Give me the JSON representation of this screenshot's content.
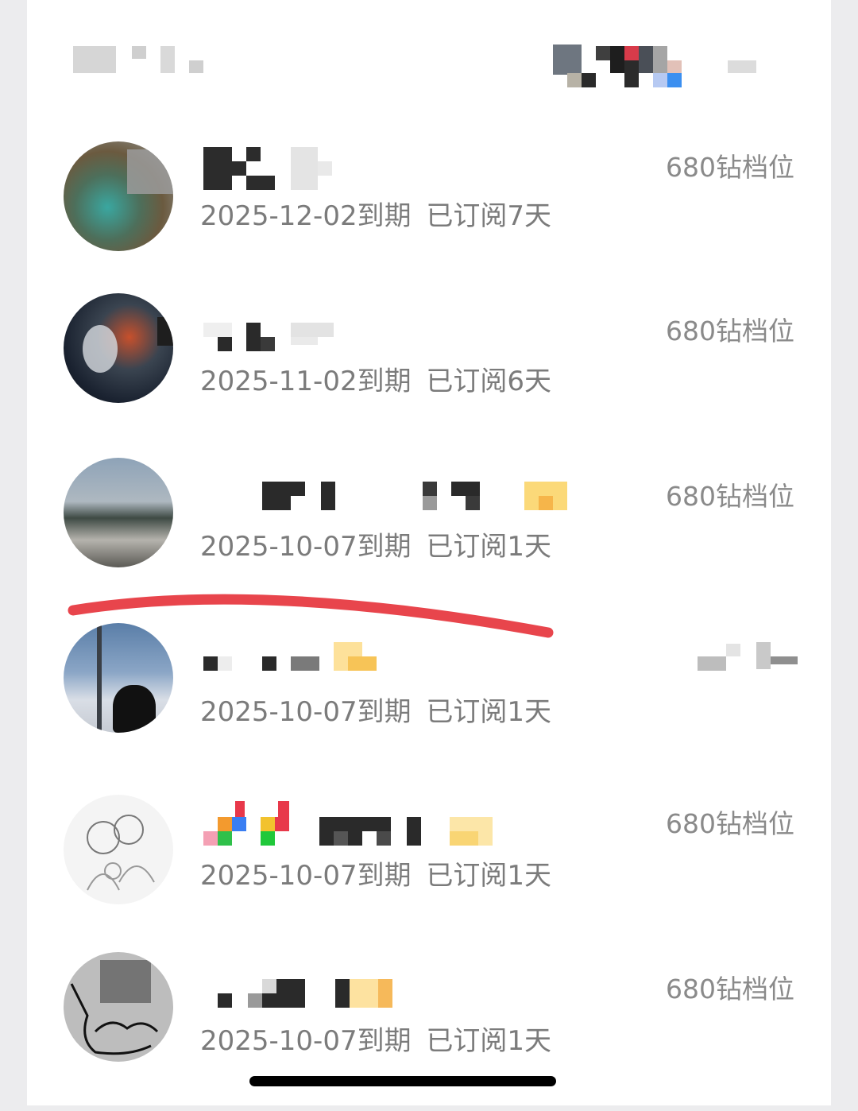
{
  "list": {
    "items": [
      {
        "expiry": "2025-12-02到期",
        "subscribed": "已订阅7天",
        "tier": "680钻档位"
      },
      {
        "expiry": "2025-11-02到期",
        "subscribed": "已订阅6天",
        "tier": "680钻档位"
      },
      {
        "expiry": "2025-10-07到期",
        "subscribed": "已订阅1天",
        "tier": "680钻档位"
      },
      {
        "expiry": "2025-10-07到期",
        "subscribed": "已订阅1天",
        "tier": ""
      },
      {
        "expiry": "2025-10-07到期",
        "subscribed": "已订阅1天",
        "tier": "680钻档位"
      },
      {
        "expiry": "2025-10-07到期",
        "subscribed": "已订阅1天",
        "tier": "680钻档位"
      }
    ]
  },
  "annotation": {
    "marker_color": "#e8454c"
  },
  "colors": {
    "tier_text": "#8a8a8a",
    "sub_text": "#7b7b7b",
    "background": "#ffffff"
  }
}
